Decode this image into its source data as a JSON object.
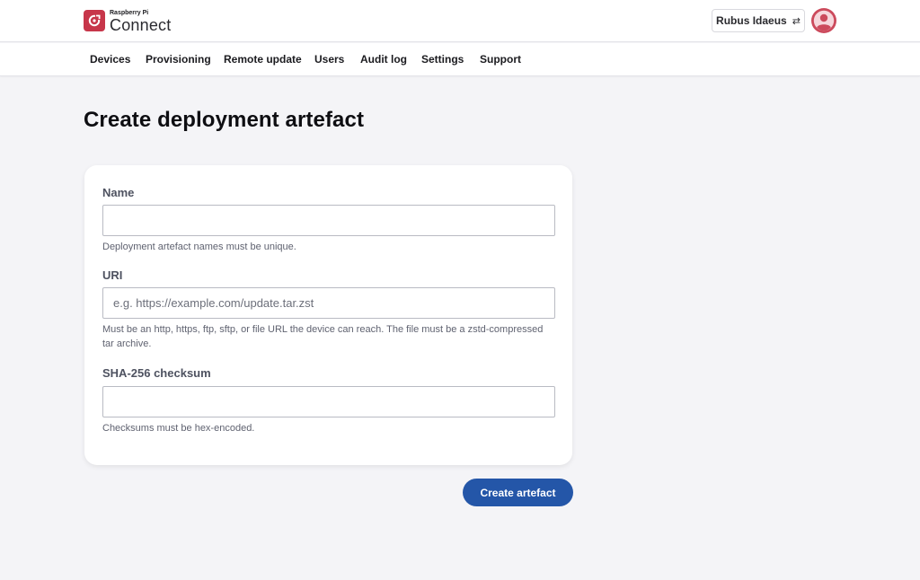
{
  "brand": {
    "small": "Raspberry Pi",
    "name": "Connect",
    "icon": "raspberry-pi-connect-logo-icon",
    "color": "#c7364a"
  },
  "header": {
    "org_name": "Rubus Idaeus",
    "org_switch_icon": "swap-arrows-icon",
    "avatar_icon": "user-avatar-icon",
    "avatar_color": "#cc4a5c"
  },
  "nav": {
    "items": [
      {
        "label": "Devices"
      },
      {
        "label": "Provisioning"
      },
      {
        "label": "Remote update"
      },
      {
        "label": "Users"
      },
      {
        "label": "Audit log"
      },
      {
        "label": "Settings"
      },
      {
        "label": "Support"
      }
    ]
  },
  "page": {
    "title": "Create deployment artefact"
  },
  "form": {
    "name": {
      "label": "Name",
      "value": "",
      "placeholder": "",
      "help": "Deployment artefact names must be unique."
    },
    "uri": {
      "label": "URI",
      "value": "",
      "placeholder": "e.g. https://example.com/update.tar.zst",
      "help": "Must be an http, https, ftp, sftp, or file URL the device can reach. The file must be a zstd-compressed tar archive."
    },
    "checksum": {
      "label": "SHA-256 checksum",
      "value": "",
      "placeholder": "",
      "help": "Checksums must be hex-encoded."
    },
    "submit_label": "Create artefact",
    "accent_color": "#2456a8"
  }
}
